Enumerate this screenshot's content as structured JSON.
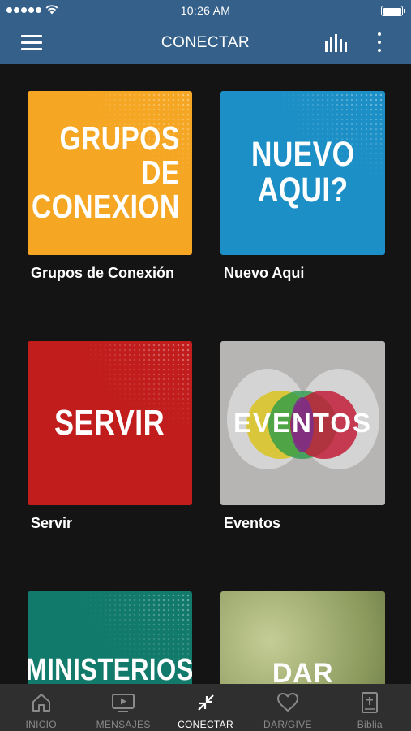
{
  "status_bar": {
    "time": "10:26 AM"
  },
  "header": {
    "title": "CONECTAR"
  },
  "cards": [
    {
      "tile_text": [
        "GRUPOS",
        "DE",
        "CONEXION"
      ],
      "label": "Grupos de Conexión",
      "color": "#f5a623"
    },
    {
      "tile_text": [
        "NUEVO",
        "AQUI?"
      ],
      "label": "Nuevo Aqui",
      "color": "#1b8fc6"
    },
    {
      "tile_text": [
        "SERVIR"
      ],
      "label": "Servir",
      "color": "#c11d1d"
    },
    {
      "tile_text": [
        "EVENTOS"
      ],
      "label": "Eventos",
      "color": "#b7b5b4"
    },
    {
      "tile_text": [
        "MINISTERIOS"
      ],
      "label": "",
      "color": "#127a6b"
    },
    {
      "tile_text": [
        "DAR"
      ],
      "label": "",
      "color": "#8c9a5e"
    }
  ],
  "tabs": [
    {
      "label": "INICIO",
      "icon": "home-icon",
      "active": false
    },
    {
      "label": "MENSAJES",
      "icon": "video-icon",
      "active": false
    },
    {
      "label": "CONECTAR",
      "icon": "collapse-arrows-icon",
      "active": true
    },
    {
      "label": "DAR/GIVE",
      "icon": "heart-icon",
      "active": false
    },
    {
      "label": "Biblia",
      "icon": "bible-icon",
      "active": false
    }
  ]
}
